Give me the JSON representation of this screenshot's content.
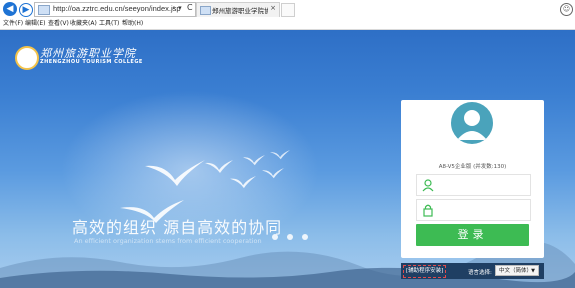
{
  "browser": {
    "url": "http://oa.zztrc.edu.cn/seeyon/index.jsp",
    "search_glyph": "⌕ ▾",
    "refresh_glyph": "C",
    "tab_title": "郑州旅游职业学院协同办公...",
    "tab_close": "×",
    "menu": [
      "文件(F)",
      "编辑(E)",
      "查看(V)",
      "收藏夹(A)",
      "工具(T)",
      "帮助(H)"
    ]
  },
  "logo": {
    "name_cn": "郑州旅游职业学院",
    "name_en": "ZHENGZHOU TOURISM COLLEGE"
  },
  "banner": {
    "slogan_cn": "高效的组织  源自高效的协同",
    "slogan_en": "An efficient organization stems from efficient cooperation",
    "carousel_count": 3
  },
  "login": {
    "version": "A8-V5企业版 (并发数:130)",
    "username_placeholder": "",
    "password_placeholder": "",
    "submit_label": "登录",
    "plugin_link": "[辅助程序安装]",
    "language_label": "语言选择:",
    "language_value": "中文（简体）"
  },
  "colors": {
    "login_button": "#3dbb53",
    "avatar": "#4aa3bb",
    "footer_bar": "#1f3f63",
    "plugin_border": "#e14b4b",
    "sky_top": "#2e6fc6",
    "sky_bottom": "#a9cdef"
  }
}
